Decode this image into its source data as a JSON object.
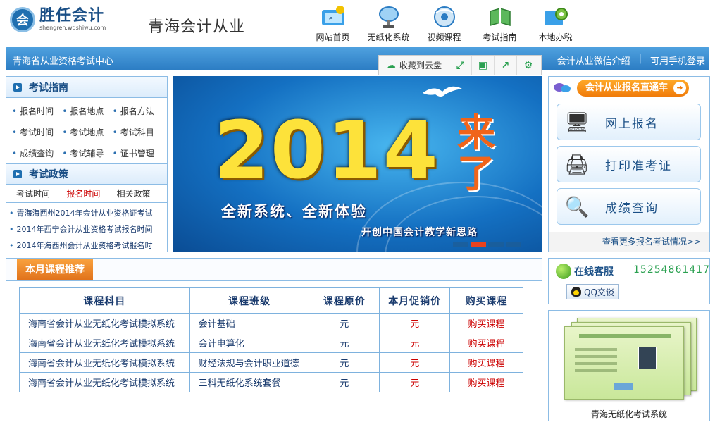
{
  "header": {
    "logo_name": "胜任会计",
    "logo_url": "shengren.wdshiwu.com",
    "site_title": "青海会计从业",
    "nav": [
      {
        "label": "网站首页",
        "icon": "home-icon"
      },
      {
        "label": "无纸化系统",
        "icon": "satellite-icon"
      },
      {
        "label": "视频课程",
        "icon": "video-disc-icon"
      },
      {
        "label": "考试指南",
        "icon": "book-icon"
      },
      {
        "label": "本地办税",
        "icon": "gear-folder-icon"
      }
    ]
  },
  "bluebar": {
    "title": "青海省从业资格考试中心",
    "wechat": "会计从业微信介绍",
    "mobile": "可用手机登录"
  },
  "cloudbar": {
    "save_label": "收藏到云盘"
  },
  "guide": {
    "title": "考试指南",
    "rows": [
      [
        "报名时间",
        "报名地点",
        "报名方法"
      ],
      [
        "考试时间",
        "考试地点",
        "考试科目"
      ],
      [
        "成绩查询",
        "考试辅导",
        "证书管理"
      ]
    ]
  },
  "policy": {
    "title": "考试政策",
    "tabs": [
      "考试时间",
      "报名时间",
      "相关政策"
    ],
    "items": [
      "青海海西州2014年会计从业资格证考试",
      "2014年西宁会计从业资格考试报名时间",
      "2014年海西州会计从业资格考试报名时"
    ]
  },
  "banner": {
    "year": "2014",
    "come": "来了",
    "slogan": "全新系统、全新体验",
    "sub": "开创中国会计教学新思路"
  },
  "register": {
    "title": "会计从业报名直通车",
    "buttons": [
      {
        "label": "网上报名",
        "icon": "computer-form-icon"
      },
      {
        "label": "打印准考证",
        "icon": "printer-icon"
      },
      {
        "label": "成绩查询",
        "icon": "magnifier-icon"
      }
    ],
    "more": "查看更多报名考试情况>>"
  },
  "courses": {
    "tab": "本月课程推荐",
    "headers": [
      "课程科目",
      "课程班级",
      "课程原价",
      "本月促销价",
      "购买课程"
    ],
    "rows": [
      {
        "subject": "海南省会计从业无纸化考试模拟系统",
        "class": "会计基础",
        "orig": "元",
        "promo": "元",
        "buy": "购买课程"
      },
      {
        "subject": "海南省会计从业无纸化考试模拟系统",
        "class": "会计电算化",
        "orig": "元",
        "promo": "元",
        "buy": "购买课程"
      },
      {
        "subject": "海南省会计从业无纸化考试模拟系统",
        "class": "财经法规与会计职业道德",
        "orig": "元",
        "promo": "元",
        "buy": "购买课程"
      },
      {
        "subject": "海南省会计从业无纸化考试模拟系统",
        "class": "三科无纸化系统套餐",
        "orig": "元",
        "promo": "元",
        "buy": "购买课程"
      }
    ]
  },
  "service": {
    "title": "在线客服",
    "phone": "15254861417",
    "qq": "QQ交谈"
  },
  "system": {
    "label": "青海无纸化考试系统"
  },
  "colors": {
    "primary_blue": "#2b7cc3",
    "accent_orange": "#f07b0a",
    "price_red": "#cc0000"
  }
}
